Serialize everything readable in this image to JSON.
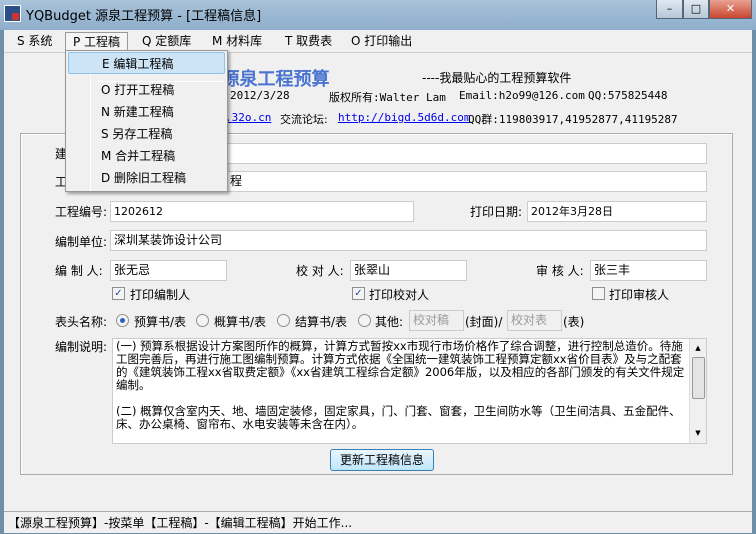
{
  "window": {
    "title": "YQBudget 源泉工程预算 - [工程稿信息]",
    "min": "–",
    "max": "□",
    "close": "✕"
  },
  "menubar": [
    "S 系统",
    "P 工程稿",
    "Q 定额库",
    "M 材料库",
    "T 取费表",
    "O 打印输出"
  ],
  "dropdown": {
    "items": [
      "E 编辑工程稿",
      "O 打开工程稿",
      "N 新建工程稿",
      "S 另存工程稿",
      "M 合并工程稿",
      "D 删除旧工程稿"
    ]
  },
  "header": {
    "title": "YQBudget 源泉工程预算",
    "slogan": "----我最贴心的工程预算软件",
    "date": "2012/3/28",
    "copyright": "版权所有:Walter Lam",
    "email": "Email:h2o99@126.com",
    "qq": "QQ:575825448",
    "site": ".32o.cn",
    "forum_label": "交流论坛:",
    "forum_url": "http://bigd.5d6d.com",
    "qq_group": "QQ群:119803917,41952877,41195287"
  },
  "form": {
    "label_build": "建",
    "label_project": "工",
    "project_suffix": "程",
    "label_number": "工程编号:",
    "number": "1202612",
    "label_print_date": "打印日期:",
    "print_date": "2012年3月28日",
    "label_unit": "编制单位:",
    "unit": "深圳某装饰设计公司",
    "label_author": "编 制 人:",
    "author": "张无忌",
    "label_checker": "校 对 人:",
    "checker": "张翠山",
    "label_reviewer": "审 核 人:",
    "reviewer": "张三丰",
    "cb_author": "打印编制人",
    "cb_checker": "打印校对人",
    "cb_reviewer": "打印审核人",
    "label_header": "表头名称:",
    "r1": "预算书/表",
    "r2": "概算书/表",
    "r3": "结算书/表",
    "r4": "其他:",
    "other_cover": "校对稿",
    "cover_suffix": "(封面)/",
    "other_table": "校对表",
    "table_suffix": "(表)",
    "label_desc": "编制说明:",
    "desc1": "(一) 预算系根据设计方案图所作的概算，计算方式暂按xx市现行市场价格作了综合调整，进行控制总造价。待施工图完善后，再进行施工图编制预算。计算方式依据《全国统一建筑装饰工程预算定额xx省价目表》及与之配套的《建筑装饰工程xx省取费定额》《xx省建筑工程综合定额》2006年版，以及相应的各部门颁发的有关文件规定编制。",
    "desc2": "(二) 概算仅含室内天、地、墙固定装修，固定家具，门、门套、窗套，卫生间防水等（卫生间洁具、五金配件、床、办公桌椅、窗帘布、水电安装等未含在内）。",
    "update_button": "更新工程稿信息"
  },
  "status": "【源泉工程预算】-按菜单【工程稿】-【编辑工程稿】开始工作..."
}
